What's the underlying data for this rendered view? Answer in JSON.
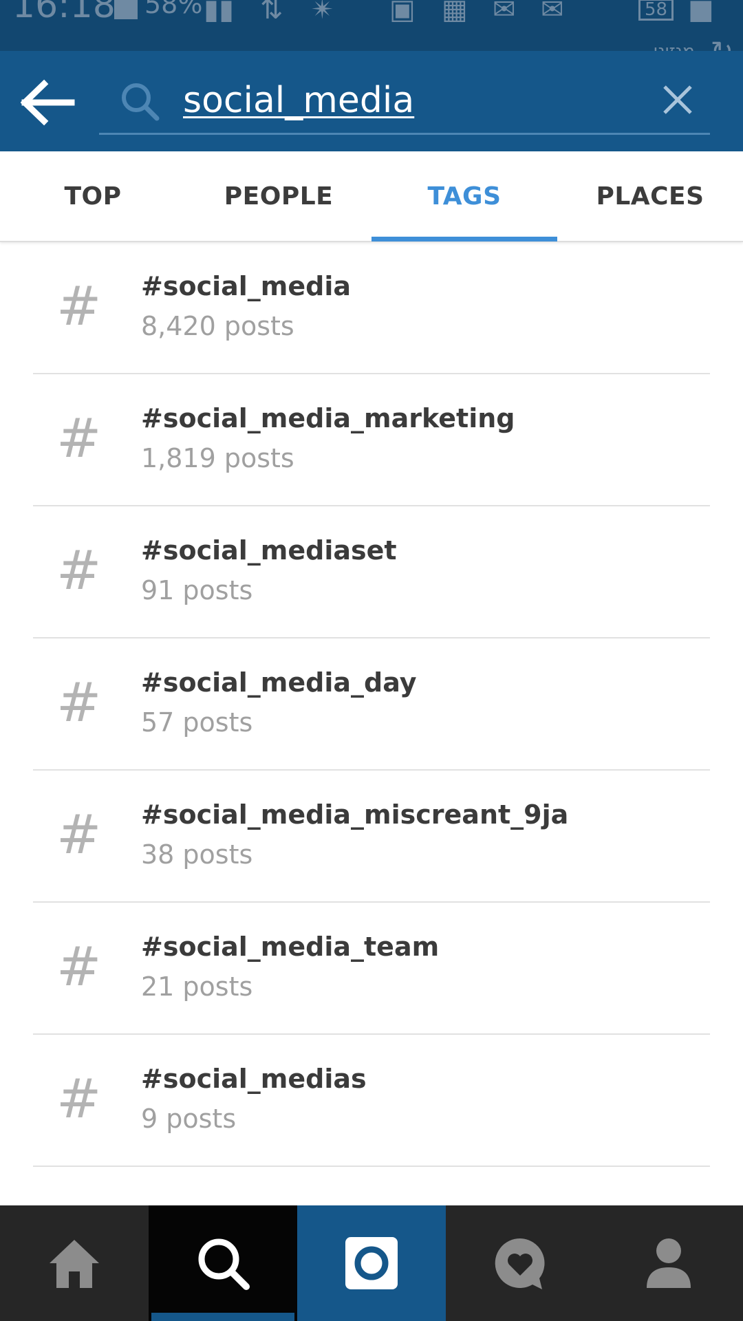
{
  "status_bar": {
    "time": "16:18",
    "battery": "58%",
    "notification_count": "58",
    "peek_text": "מגזינו"
  },
  "search": {
    "query": "social_media"
  },
  "tabs": [
    {
      "label": "TOP",
      "active": false
    },
    {
      "label": "PEOPLE",
      "active": false
    },
    {
      "label": "TAGS",
      "active": true
    },
    {
      "label": "PLACES",
      "active": false
    }
  ],
  "tags": [
    {
      "symbol": "#",
      "name": "#social_media",
      "count": "8,420 posts"
    },
    {
      "symbol": "#",
      "name": "#social_media_marketing",
      "count": "1,819 posts"
    },
    {
      "symbol": "#",
      "name": "#social_mediaset",
      "count": "91 posts"
    },
    {
      "symbol": "#",
      "name": "#social_media_day",
      "count": "57 posts"
    },
    {
      "symbol": "#",
      "name": "#social_media_miscreant_9ja",
      "count": "38 posts"
    },
    {
      "symbol": "#",
      "name": "#social_media_team",
      "count": "21 posts"
    },
    {
      "symbol": "#",
      "name": "#social_medias",
      "count": "9 posts"
    }
  ],
  "bottom_nav": [
    {
      "icon": "home-icon"
    },
    {
      "icon": "search-icon",
      "active": true
    },
    {
      "icon": "camera-icon"
    },
    {
      "icon": "activity-heart-icon"
    },
    {
      "icon": "profile-icon"
    }
  ],
  "colors": {
    "header": "#15578a",
    "status_bar": "#124770",
    "accent": "#3e8fd8",
    "nav_bg": "#262626"
  }
}
